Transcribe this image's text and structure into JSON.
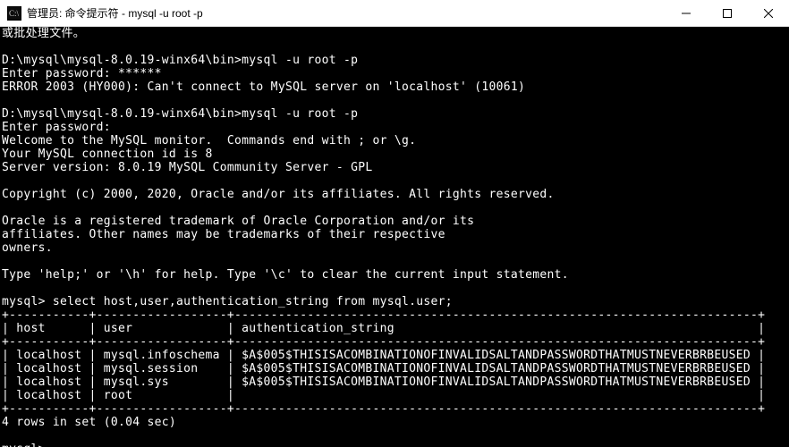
{
  "window": {
    "title": "管理员: 命令提示符 - mysql  -u root -p"
  },
  "terminal": {
    "lines": [
      "或批处理文件。",
      "",
      "D:\\mysql\\mysql-8.0.19-winx64\\bin>mysql -u root -p",
      "Enter password: ******",
      "ERROR 2003 (HY000): Can't connect to MySQL server on 'localhost' (10061)",
      "",
      "D:\\mysql\\mysql-8.0.19-winx64\\bin>mysql -u root -p",
      "Enter password:",
      "Welcome to the MySQL monitor.  Commands end with ; or \\g.",
      "Your MySQL connection id is 8",
      "Server version: 8.0.19 MySQL Community Server - GPL",
      "",
      "Copyright (c) 2000, 2020, Oracle and/or its affiliates. All rights reserved.",
      "",
      "Oracle is a registered trademark of Oracle Corporation and/or its",
      "affiliates. Other names may be trademarks of their respective",
      "owners.",
      "",
      "Type 'help;' or '\\h' for help. Type '\\c' to clear the current input statement.",
      "",
      "mysql> select host,user,authentication_string from mysql.user;",
      "+-----------+------------------+------------------------------------------------------------------------+",
      "| host      | user             | authentication_string                                                  |",
      "+-----------+------------------+------------------------------------------------------------------------+",
      "| localhost | mysql.infoschema | $A$005$THISISACOMBINATIONOFINVALIDSALTANDPASSWORDTHATMUSTNEVERBRBEUSED |",
      "| localhost | mysql.session    | $A$005$THISISACOMBINATIONOFINVALIDSALTANDPASSWORDTHATMUSTNEVERBRBEUSED |",
      "| localhost | mysql.sys        | $A$005$THISISACOMBINATIONOFINVALIDSALTANDPASSWORDTHATMUSTNEVERBRBEUSED |",
      "| localhost | root             |                                                                        |",
      "+-----------+------------------+------------------------------------------------------------------------+",
      "4 rows in set (0.04 sec)",
      "",
      "mysql>"
    ],
    "query_result": {
      "columns": [
        "host",
        "user",
        "authentication_string"
      ],
      "rows": [
        [
          "localhost",
          "mysql.infoschema",
          "$A$005$THISISACOMBINATIONOFINVALIDSALTANDPASSWORDTHATMUSTNEVERBRBEUSED"
        ],
        [
          "localhost",
          "mysql.session",
          "$A$005$THISISACOMBINATIONOFINVALIDSALTANDPASSWORDTHATMUSTNEVERBRBEUSED"
        ],
        [
          "localhost",
          "mysql.sys",
          "$A$005$THISISACOMBINATIONOFINVALIDSALTANDPASSWORDTHATMUSTNEVERBRBEUSED"
        ],
        [
          "localhost",
          "root",
          ""
        ]
      ],
      "summary": "4 rows in set (0.04 sec)"
    }
  }
}
